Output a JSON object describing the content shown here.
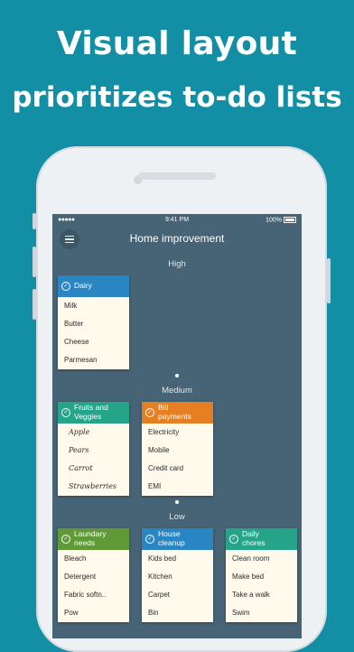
{
  "headline": {
    "line1": "Visual layout",
    "line2": "prioritizes to-do lists"
  },
  "status_bar": {
    "signal": "●●●●●",
    "time": "9:41 PM",
    "battery": "100%"
  },
  "app": {
    "title": "Home improvement",
    "menu_icon": "hamburger-icon"
  },
  "sections": {
    "high": "High",
    "medium": "Medium",
    "low": "Low"
  },
  "cards": {
    "dairy": {
      "title": "Dairy",
      "color": "#2a86c2",
      "items": [
        "Milk",
        "Butter",
        "Cheese",
        "Parmesan"
      ]
    },
    "fruits": {
      "title_line1": "Fruits and",
      "title_line2": "Veggies",
      "color": "#25a489",
      "items": [
        "Apple",
        "Pears",
        "Carrot",
        "Strawberries"
      ]
    },
    "bills": {
      "title_line1": "Bill",
      "title_line2": "payments",
      "color": "#e67e22",
      "items": [
        "Electricity",
        "Mobile",
        "Credit card",
        "EMI"
      ]
    },
    "laundary": {
      "title_line1": "Laundary",
      "title_line2": "needs",
      "color": "#5f9a37",
      "items": [
        "Bleach",
        "Detergent",
        "Fabric softn..",
        "Pow"
      ]
    },
    "house": {
      "title_line1": "House",
      "title_line2": "cleanup",
      "color": "#2a86c2",
      "items": [
        "Kids bed",
        "Kitchen",
        "Carpet",
        "Bin"
      ]
    },
    "chores": {
      "title_line1": "Daily",
      "title_line2": "chores",
      "color": "#25a489",
      "items": [
        "Clean room",
        "Make bed",
        "Take a walk",
        "Swim"
      ]
    }
  }
}
